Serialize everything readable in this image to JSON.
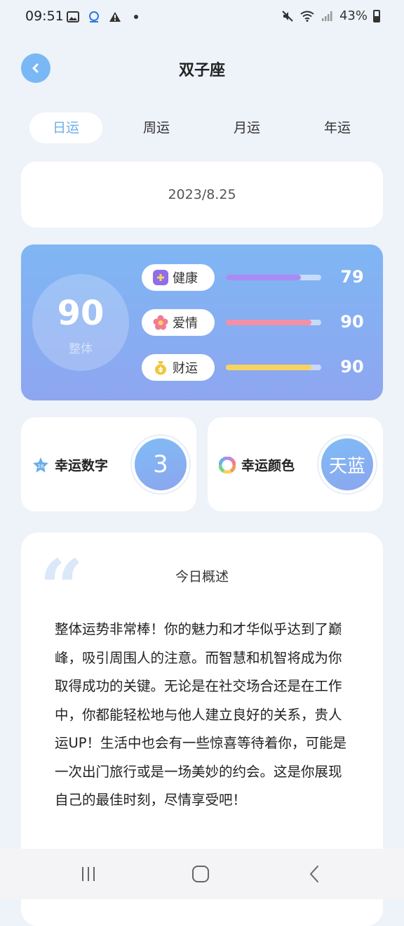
{
  "status_bar": {
    "time": "09:51",
    "battery": "43%"
  },
  "header": {
    "title": "双子座",
    "back_icon": "chevron-left-icon"
  },
  "tabs": [
    {
      "label": "日运",
      "active": true
    },
    {
      "label": "周运",
      "active": false
    },
    {
      "label": "月运",
      "active": false
    },
    {
      "label": "年运",
      "active": false
    }
  ],
  "date": "2023/8.25",
  "overall": {
    "score": "90",
    "label": "整体"
  },
  "metrics": [
    {
      "label": "健康",
      "value": "79",
      "fraction": 0.79,
      "color": "#a98cf3",
      "icon": "medical-kit-icon",
      "icon_color": "#8f6ee8"
    },
    {
      "label": "爱情",
      "value": "90",
      "fraction": 0.9,
      "color": "#f38fa6",
      "icon": "flower-icon",
      "icon_color": "#f27a95"
    },
    {
      "label": "财运",
      "value": "90",
      "fraction": 0.9,
      "color": "#f7d35f",
      "icon": "money-bag-icon",
      "icon_color": "#f2c53d"
    }
  ],
  "lucky_number": {
    "title": "幸运数字",
    "value": "3",
    "icon": "star-badge-icon"
  },
  "lucky_color": {
    "title": "幸运颜色",
    "value": "天蓝",
    "icon": "color-wheel-icon"
  },
  "overview": {
    "title": "今日概述",
    "text": "整体运势非常棒！你的魅力和才华似乎达到了巅峰，吸引周围人的注意。而智慧和机智将成为你取得成功的关键。无论是在社交场合还是在工作中，你都能轻松地与他人建立良好的关系，贵人运UP！生活中也会有一些惊喜等待着你，可能是一次出门旅行或是一场美妙的约会。这是你展现自己的最佳时刻，尽情享受吧！"
  },
  "colors": {
    "accent": "#6aaee8",
    "back_button": "#7ab8f5",
    "background": "#eef2f9"
  }
}
